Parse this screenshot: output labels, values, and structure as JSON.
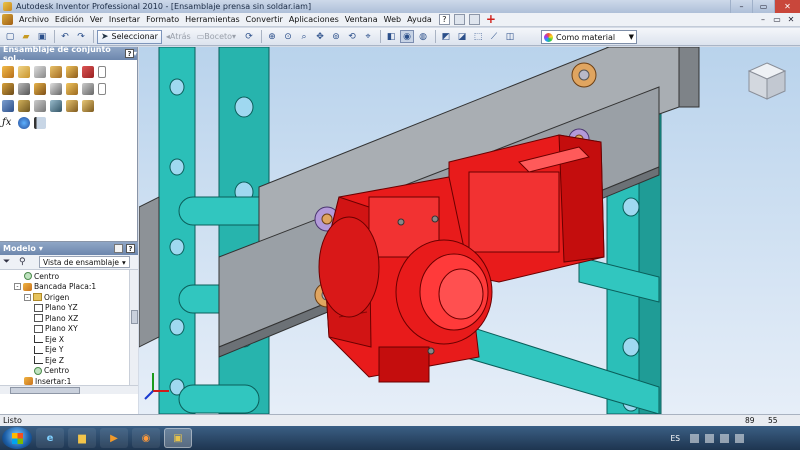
{
  "window": {
    "title": "Autodesk Inventor Professional 2010 - [Ensamblaje prensa sin soldar.iam]",
    "minimize": "–",
    "restore": "▭",
    "close": "✕"
  },
  "menu": {
    "items": [
      "Archivo",
      "Edición",
      "Ver",
      "Insertar",
      "Formato",
      "Herramientas",
      "Convertir",
      "Aplicaciones",
      "Ventana",
      "Web",
      "Ayuda"
    ],
    "help_icon": "?"
  },
  "toolbar": {
    "select_label": "Seleccionar",
    "back_label": "Atrás",
    "sketch_label": "Boceto",
    "material_label": "Como material"
  },
  "panel_tools": {
    "title": "Ensamblaje de conjunto sol..."
  },
  "browser": {
    "title": "Modelo",
    "view_select": "Vista de ensamblaje",
    "tree": [
      {
        "label": "Centro",
        "indent": 2,
        "icon": "pt"
      },
      {
        "label": "Bancada Placa:1",
        "indent": 1,
        "icon": "comp",
        "expander": "-"
      },
      {
        "label": "Origen",
        "indent": 2,
        "icon": "fold",
        "expander": "-"
      },
      {
        "label": "Plano YZ",
        "indent": 3,
        "icon": "plane"
      },
      {
        "label": "Plano XZ",
        "indent": 3,
        "icon": "plane"
      },
      {
        "label": "Plano XY",
        "indent": 3,
        "icon": "plane"
      },
      {
        "label": "Eje X",
        "indent": 3,
        "icon": "axis"
      },
      {
        "label": "Eje Y",
        "indent": 3,
        "icon": "axis"
      },
      {
        "label": "Eje Z",
        "indent": 3,
        "icon": "axis"
      },
      {
        "label": "Centro",
        "indent": 3,
        "icon": "pt"
      },
      {
        "label": "Insertar:1",
        "indent": 2,
        "icon": "comp"
      }
    ]
  },
  "status": {
    "text": "Listo",
    "num1": "89",
    "num2": "55"
  },
  "taskbar": {
    "lang": "ES"
  },
  "colors": {
    "motor_red": "#e81b1b",
    "frame_cyan": "#2bbfb8",
    "plate_gray": "#9aa0a6",
    "bg_top": "#b9d3ec"
  }
}
